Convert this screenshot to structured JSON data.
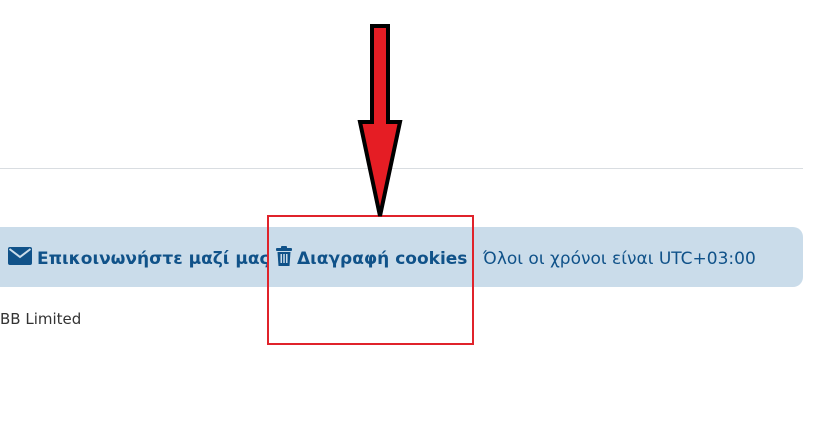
{
  "footer": {
    "contact_label": "Επικοινωνήστε μαζί μας",
    "contact_icon": "envelope-icon",
    "delete_cookies_label": "Διαγραφή cookies",
    "delete_cookies_icon": "trash-icon",
    "timezone_text": "Όλοι οι χρόνοι είναι UTC+03:00",
    "copyright_text": "BB Limited"
  },
  "annotation": {
    "arrow_icon": "down-arrow-icon",
    "highlight_color": "#e0232b"
  },
  "colors": {
    "navbar_bg": "#cadcea",
    "link_color": "#105289"
  }
}
